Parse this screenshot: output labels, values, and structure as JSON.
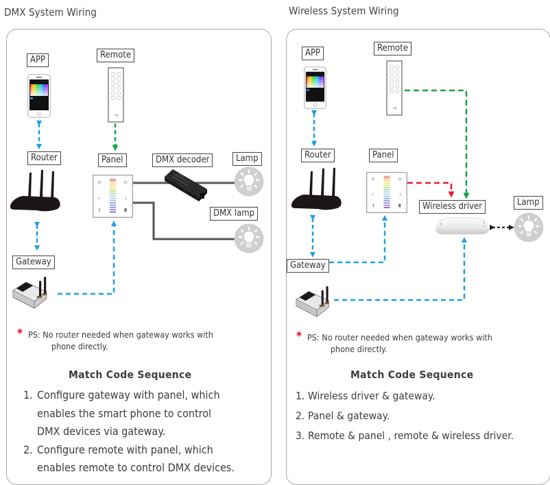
{
  "dmx": {
    "title": "DMX System Wiring",
    "labels": {
      "app": "APP",
      "remote": "Remote",
      "router": "Router",
      "panel": "Panel",
      "decoder": "DMX decoder",
      "lamp": "Lamp",
      "dmx_lamp": "DMX lamp",
      "gateway": "Gateway"
    },
    "note_prefix": "PS:",
    "note_line1": "No router needed when gateway works with",
    "note_line2": "phone directly.",
    "sequence_title": "Match Code Sequence",
    "steps": [
      {
        "num": "1.",
        "lines": [
          "Configure gateway with panel, which",
          "enables the smart phone to control",
          "DMX devices via gateway."
        ]
      },
      {
        "num": "2.",
        "lines": [
          "Configure remote with panel, which",
          "enables remote to control DMX devices."
        ]
      }
    ]
  },
  "wireless": {
    "title": "Wireless System Wiring",
    "labels": {
      "app": "APP",
      "remote": "Remote",
      "router": "Router",
      "panel": "Panel",
      "driver": "Wireless driver",
      "lamp": "Lamp",
      "gateway": "Gateway"
    },
    "note_prefix": "PS:",
    "note_line1": "No router needed when gateway works with",
    "note_line2": "phone directly.",
    "sequence_title": "Match Code Sequence",
    "steps": [
      {
        "num": "1.",
        "lines": [
          "Wireless driver & gateway."
        ]
      },
      {
        "num": "2.",
        "lines": [
          "Panel & gateway."
        ]
      },
      {
        "num": "3.",
        "lines": [
          "Remote & panel , remote & wireless driver."
        ]
      }
    ]
  },
  "colors": {
    "wifi_link": "#1aa0e6",
    "remote_link": "#16a04a",
    "panel_link": "#e5192e",
    "wired_link": "#555555",
    "lamp_link": "#222222",
    "asterisk": "#e0001b"
  }
}
